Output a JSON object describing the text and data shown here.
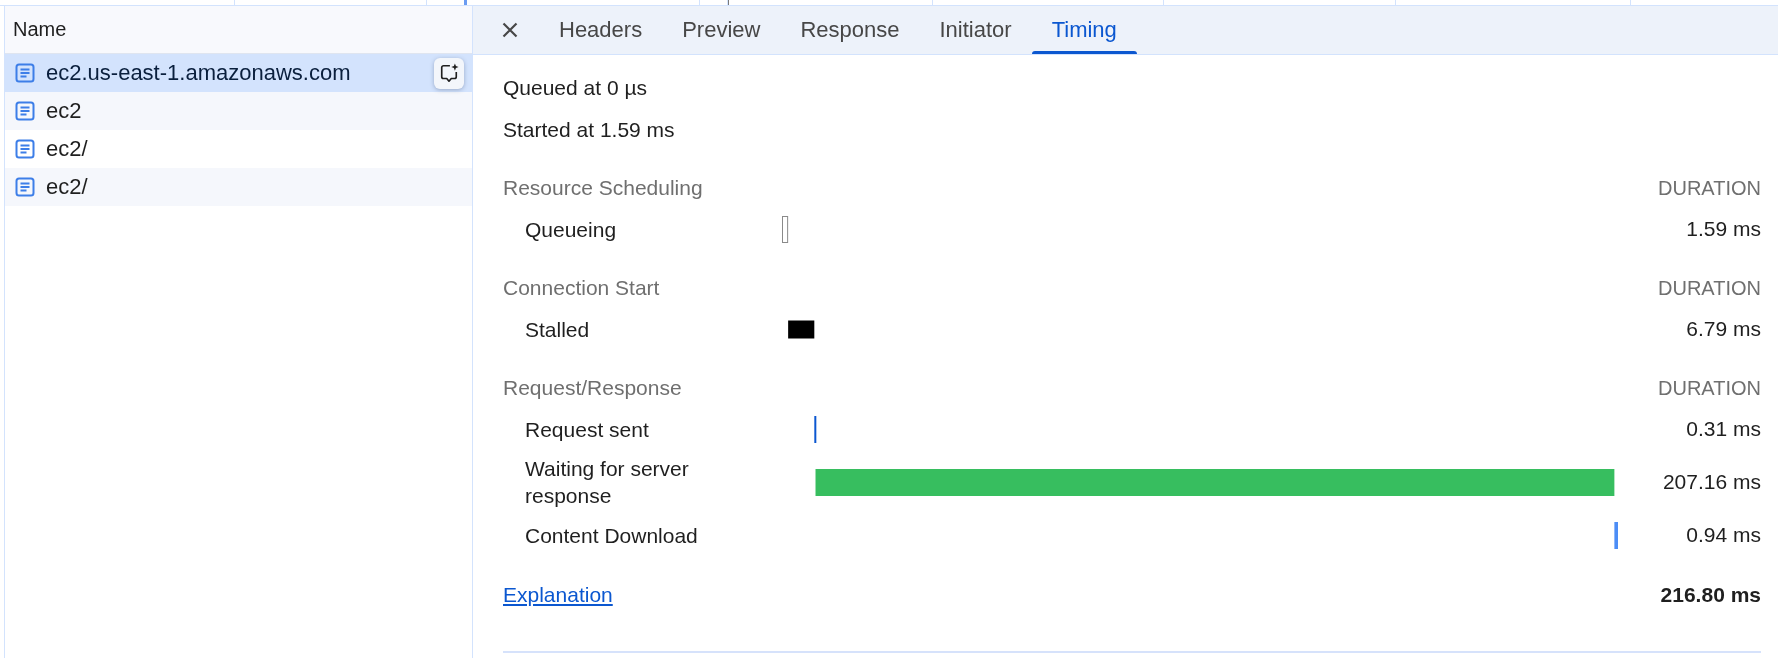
{
  "request_list": {
    "column_header": "Name",
    "rows": [
      {
        "name": "ec2.us-east-1.amazonaws.com",
        "selected": true
      },
      {
        "name": "ec2",
        "selected": false
      },
      {
        "name": "ec2/",
        "selected": false
      },
      {
        "name": "ec2/",
        "selected": false
      }
    ]
  },
  "detail_tabs": [
    {
      "label": "Headers",
      "selected": false
    },
    {
      "label": "Preview",
      "selected": false
    },
    {
      "label": "Response",
      "selected": false
    },
    {
      "label": "Initiator",
      "selected": false
    },
    {
      "label": "Timing",
      "selected": true
    }
  ],
  "timing": {
    "info_lines": [
      "Queued at 0 µs",
      "Started at 1.59 ms"
    ],
    "sections": [
      {
        "title": "Resource Scheduling",
        "duration_heading": "DURATION",
        "phases": [
          {
            "label": "Queueing",
            "kind": "outline",
            "color": "#8a8a8a",
            "duration": "1.59 ms"
          }
        ]
      },
      {
        "title": "Connection Start",
        "duration_heading": "DURATION",
        "phases": [
          {
            "label": "Stalled",
            "kind": "slim",
            "color": "#000000",
            "duration": "6.79 ms"
          }
        ]
      },
      {
        "title": "Request/Response",
        "duration_heading": "DURATION",
        "phases": [
          {
            "label": "Request sent",
            "kind": "full",
            "color": "#0b57d0",
            "duration": "0.31 ms"
          },
          {
            "label": "Waiting for server response",
            "kind": "full",
            "color": "#37be5f",
            "duration": "207.16 ms"
          },
          {
            "label": "Content Download",
            "kind": "full",
            "color": "#4c8df6",
            "duration": "0.94 ms"
          }
        ]
      }
    ],
    "explanation_link": "Explanation",
    "total": "216.80 ms"
  }
}
